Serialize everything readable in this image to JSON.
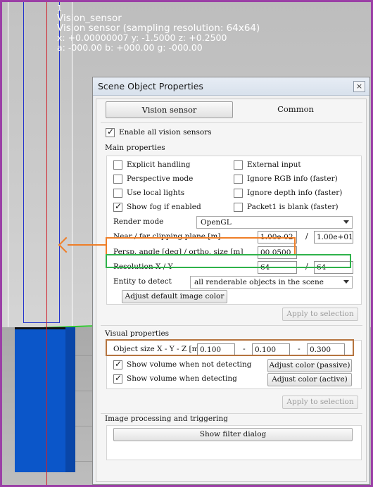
{
  "overlay": {
    "line1": "1",
    "line2": "Vision_sensor",
    "line3": "Vision sensor (sampling resolution: 64x64)",
    "line4": "x: +0.00000007   y: -1.5000   z: +0.2500",
    "line5": "a: -000.00   b: +000.00   g: -000.00"
  },
  "dialog": {
    "title": "Scene Object Properties",
    "close": "×",
    "tabs": [
      "Vision sensor",
      "Common"
    ],
    "enable_all": "Enable all vision sensors",
    "main_header": "Main properties",
    "checkboxes_left": [
      {
        "label": "Explicit handling",
        "checked": false
      },
      {
        "label": "Perspective mode",
        "checked": false
      },
      {
        "label": "Use local lights",
        "checked": false
      },
      {
        "label": "Show fog if enabled",
        "checked": true
      }
    ],
    "checkboxes_right": [
      {
        "label": "External input",
        "checked": false
      },
      {
        "label": "Ignore RGB info (faster)",
        "checked": false
      },
      {
        "label": "Ignore depth  info (faster)",
        "checked": false
      },
      {
        "label": "Packet1 is blank (faster)",
        "checked": false
      }
    ],
    "render_mode_label": "Render mode",
    "render_mode_value": "OpenGL",
    "clip_label": "Near / far clipping plane [m]",
    "clip_near": "1.00e-02",
    "clip_far": "1.00e+01",
    "persp_label": "Persp. angle [deg] / ortho. size [m]",
    "persp_value": "00.0500",
    "res_label": "Resolution X / Y",
    "res_x": "64",
    "res_y": "64",
    "entity_label": "Entity to detect",
    "entity_value": "all renderable objects in the scene",
    "adjust_image_color": "Adjust default image color",
    "apply1": "Apply to selection",
    "visual_header": "Visual properties",
    "objsize_label": "Object size X - Y - Z [m]",
    "size_x": "0.100",
    "size_y": "0.100",
    "size_z": "0.300",
    "dash": "-",
    "slash": "/",
    "show_not_detecting": "Show volume when not detecting",
    "show_detecting": "Show volume when detecting",
    "adjust_passive": "Adjust color (passive)",
    "adjust_active": "Adjust color (active)",
    "apply2": "Apply to selection",
    "image_header": "Image processing and triggering",
    "show_filter": "Show filter dialog"
  },
  "colors": {
    "frame": "#9b3fa6",
    "highlight_orange": "#ef7e27",
    "highlight_green": "#2fb24a",
    "highlight_brown": "#b5743f",
    "sensor_blue": "#0b56c9"
  }
}
